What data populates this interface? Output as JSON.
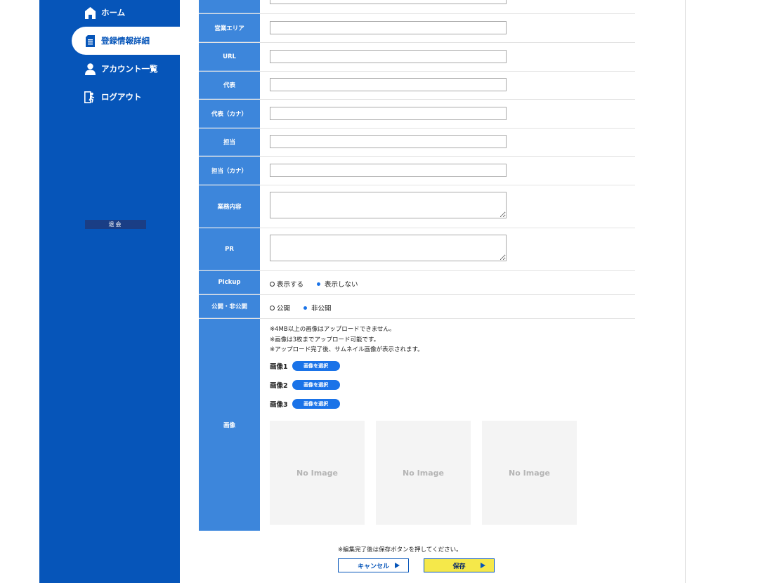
{
  "sidebar": {
    "items": [
      {
        "label": "ホーム",
        "icon": "home-icon"
      },
      {
        "label": "登録情報詳細",
        "icon": "document-icon",
        "active": true
      },
      {
        "label": "アカウント一覧",
        "icon": "user-icon"
      },
      {
        "label": "ログアウト",
        "icon": "exit-icon"
      }
    ],
    "withdraw_label": "退会"
  },
  "form": {
    "fields": [
      {
        "label": "営業エリア",
        "value": ""
      },
      {
        "label": "URL",
        "value": ""
      },
      {
        "label": "代表",
        "value": ""
      },
      {
        "label": "代表（カナ）",
        "value": ""
      },
      {
        "label": "担当",
        "value": ""
      },
      {
        "label": "担当（カナ）",
        "value": ""
      }
    ],
    "business": {
      "label": "業務内容",
      "value": ""
    },
    "pr": {
      "label": "PR",
      "value": ""
    },
    "pickup": {
      "label": "Pickup",
      "options": [
        "表示する",
        "表示しない"
      ],
      "selected": "表示しない"
    },
    "visibility": {
      "label": "公開・非公開",
      "options": [
        "公開",
        "非公開"
      ],
      "selected": "非公開"
    },
    "images": {
      "label": "画像",
      "notes": [
        "※4MB以上の画像はアップロードできません。",
        "※画像は3枚までアップロード可能です。",
        "※アップロード完了後、サムネイル画像が表示されます。"
      ],
      "slots": [
        "画像1",
        "画像2",
        "画像3"
      ],
      "select_label": "画像を選択",
      "placeholder": "No Image"
    }
  },
  "footer": {
    "note": "※編集完了後は保存ボタンを押してください。",
    "cancel_label": "キャンセル",
    "save_label": "保存"
  },
  "colors": {
    "sidebar": "#0655b9",
    "label_bg": "#3d86db",
    "accent": "#1a73e8",
    "save": "#f5e84a"
  }
}
